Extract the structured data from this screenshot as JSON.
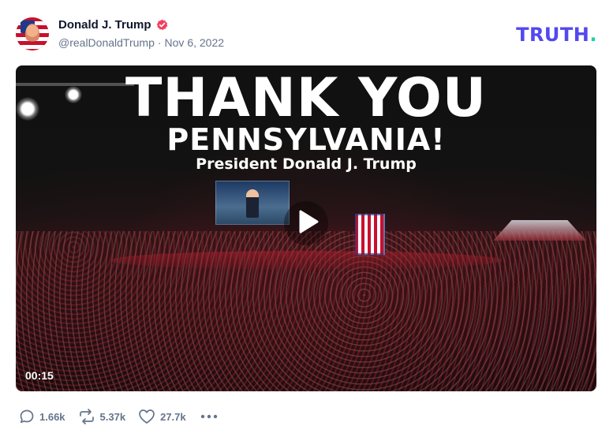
{
  "post": {
    "author_name": "Donald J. Trump",
    "handle": "@realDonaldTrump",
    "separator": "·",
    "date": "Nov 6, 2022"
  },
  "brand": {
    "logo_text": "TRUTH",
    "logo_dot": ".",
    "color": "#5448EE",
    "dot_color": "#15D4A5"
  },
  "video": {
    "headline": "THANK YOU",
    "subheadline": "PENNSYLVANIA!",
    "caption": "President Donald J. Trump",
    "duration": "00:15"
  },
  "actions": {
    "replies": "1.66k",
    "retruths": "5.37k",
    "likes": "27.7k"
  },
  "colors": {
    "verified_badge": "#F43F5E",
    "muted_text": "#64748B"
  },
  "icons": [
    "verified-badge-icon",
    "reply-icon",
    "retruth-icon",
    "like-icon",
    "more-icon",
    "play-icon"
  ]
}
